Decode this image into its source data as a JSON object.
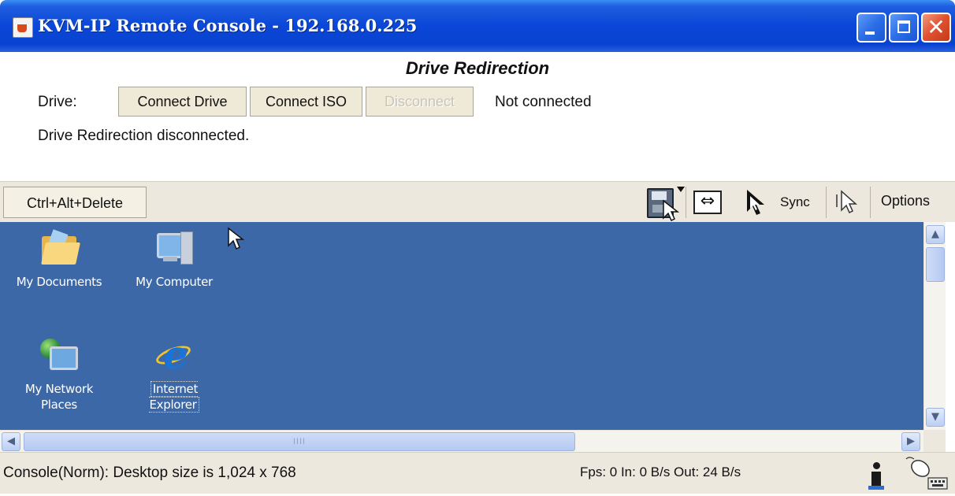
{
  "window": {
    "title": "KVM-IP Remote Console - 192.168.0.225",
    "buttons": {
      "minimize": "minimize",
      "maximize": "maximize",
      "close": "✕"
    }
  },
  "drive_panel": {
    "heading": "Drive Redirection",
    "drive_label": "Drive:",
    "connect_drive_label": "Connect Drive",
    "connect_iso_label": "Connect ISO",
    "disconnect_label": "Disconnect",
    "connection_status": "Not connected",
    "message": "Drive Redirection disconnected."
  },
  "toolbar": {
    "ctrl_alt_delete_label": "Ctrl+Alt+Delete",
    "sync_label": "Sync",
    "options_label": "Options",
    "icons": [
      "floppy-drive-icon",
      "fit-screen-icon",
      "dual-cursor-icon",
      "single-cursor-icon"
    ]
  },
  "desktop": {
    "background_color": "#3d68a8",
    "icons": [
      {
        "label": "My Documents",
        "icon": "folder-icon"
      },
      {
        "label": "My Computer",
        "icon": "computer-icon"
      },
      {
        "label": "My Network\nPlaces",
        "icon": "network-icon"
      },
      {
        "label": "Internet\nExplorer",
        "icon": "internet-explorer-icon"
      }
    ]
  },
  "scrollbars": {
    "vertical_up": "▲",
    "vertical_down": "▼",
    "horizontal_left": "◀",
    "horizontal_right": "▶",
    "thumb_grip": "IIII"
  },
  "statusbar": {
    "console_status": "Console(Norm): Desktop size is 1,024 x 768",
    "traffic": "Fps: 0 In: 0 B/s Out: 24 B/s"
  }
}
